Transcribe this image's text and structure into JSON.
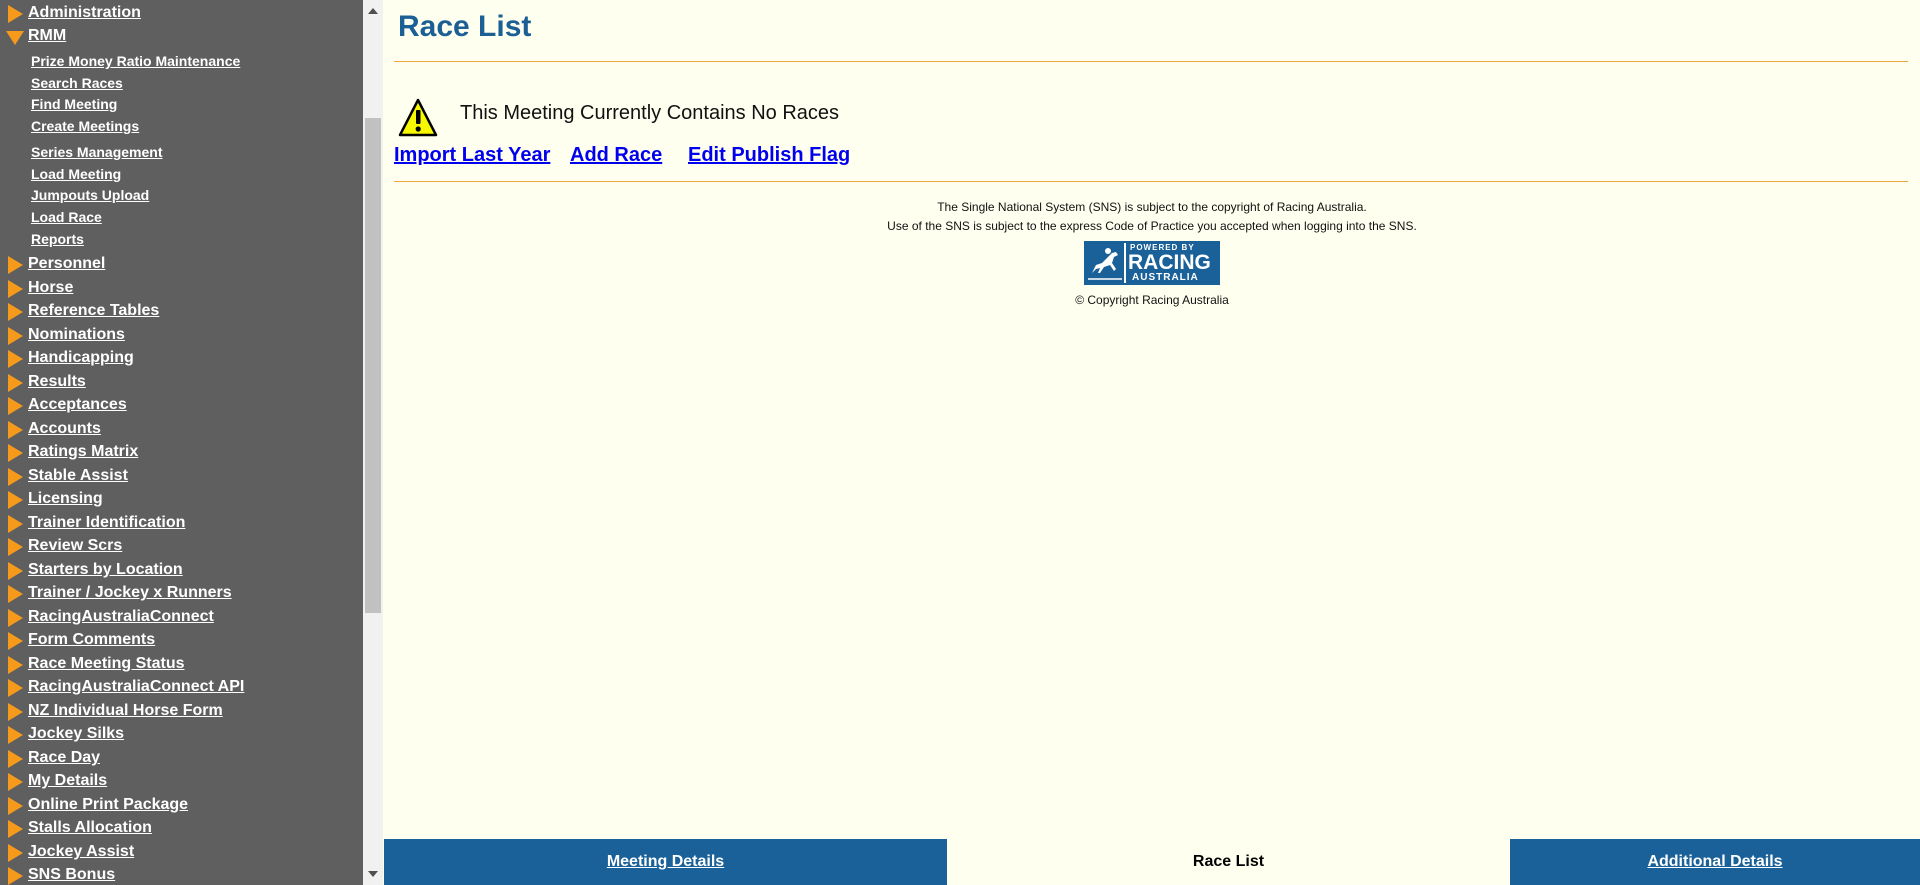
{
  "sidebar": {
    "top_items": [
      {
        "label": "Administration",
        "expanded": false
      },
      {
        "label": "RMM",
        "expanded": true
      }
    ],
    "rmm_subitems": [
      "Prize Money Ratio Maintenance",
      "Search Races",
      "Find Meeting",
      "Create Meetings",
      "Series Management",
      "Load Meeting",
      "Jumpouts Upload",
      "Load Race",
      "Reports"
    ],
    "items": [
      "Personnel",
      "Horse",
      "Reference Tables",
      "Nominations",
      "Handicapping",
      "Results",
      "Acceptances",
      "Accounts",
      "Ratings Matrix",
      "Stable Assist",
      "Licensing",
      "Trainer Identification",
      "Review Scrs",
      "Starters by Location",
      "Trainer / Jockey x Runners",
      "RacingAustraliaConnect",
      "Form Comments",
      "Race Meeting Status",
      "RacingAustraliaConnect API",
      "NZ Individual Horse Form",
      "Jockey Silks",
      "Race Day",
      "My Details",
      "Online Print Package",
      "Stalls Allocation",
      "Jockey Assist",
      "SNS Bonus"
    ],
    "arrow_color": "#f59a1b",
    "background": "#5f5f5f"
  },
  "main": {
    "title": "Race List",
    "warning_icon": "warning-icon",
    "warning_text": "This Meeting Currently Contains No Races",
    "actions": {
      "import_last_year": "Import Last Year",
      "add_race": "Add Race",
      "edit_publish_flag": "Edit Publish Flag"
    },
    "footer": {
      "line1": "The Single National System (SNS) is subject to the copyright of Racing Australia.",
      "line2": "Use of the SNS is subject to the express Code of Practice you accepted when logging into the SNS.",
      "logo": {
        "powered": "POWERED BY",
        "racing": "RACING",
        "australia": "AUSTRALIA"
      },
      "copyright": "© Copyright Racing Australia"
    }
  },
  "tabs": [
    {
      "label": "Meeting Details",
      "active": false
    },
    {
      "label": "Race List",
      "active": true
    },
    {
      "label": "Additional Details",
      "active": false
    }
  ],
  "colors": {
    "title": "#1b5f95",
    "tab_bg": "#1a6199",
    "page_bg": "#fffff0",
    "rule": "#f0a63b",
    "link": "#0000ee"
  }
}
